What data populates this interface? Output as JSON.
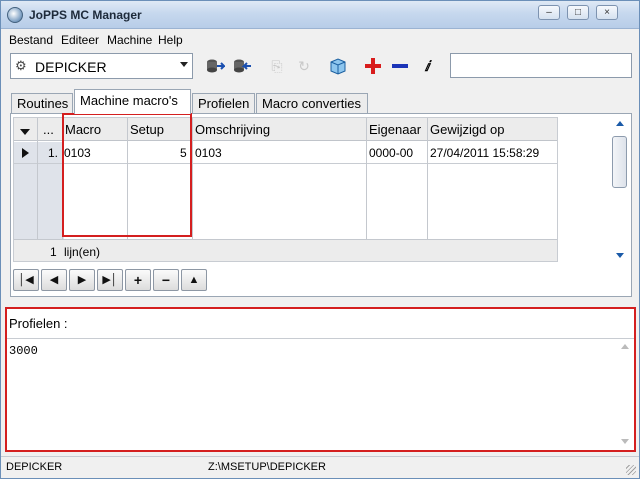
{
  "window": {
    "title": "JoPPS MC Manager"
  },
  "menu": [
    "Bestand",
    "Editeer",
    "Machine",
    "Help"
  ],
  "toolbar": {
    "machine_select": "DEPICKER",
    "icons": [
      "import-icon",
      "export-icon",
      "copy-icon",
      "refresh-icon",
      "package-icon",
      "add-icon",
      "remove-icon",
      "info-icon"
    ],
    "add_color": "#d81c1c",
    "remove_color": "#1c34b8"
  },
  "tabs": [
    "Routines",
    "Machine macro's",
    "Profielen",
    "Macro converties"
  ],
  "active_tab": "Machine macro's",
  "grid": {
    "columns": [
      "...",
      "Macro",
      "Setup",
      "Omschrijving",
      "Eigenaar",
      "Gewijzigd op"
    ],
    "rows": [
      {
        "index": "1.",
        "macro": "0103",
        "setup": "5",
        "omschrijving": "0103",
        "eigenaar": "0000-00",
        "gewijzigd": "27/04/2011 15:58:29"
      }
    ],
    "footer_count": "1",
    "footer_label": "lijn(en)"
  },
  "profielen": {
    "label": "Profielen :",
    "value": "3000"
  },
  "status": {
    "left": "DEPICKER",
    "path": "Z:\\MSETUP\\DEPICKER"
  },
  "highlight_color": "#d41f1f"
}
